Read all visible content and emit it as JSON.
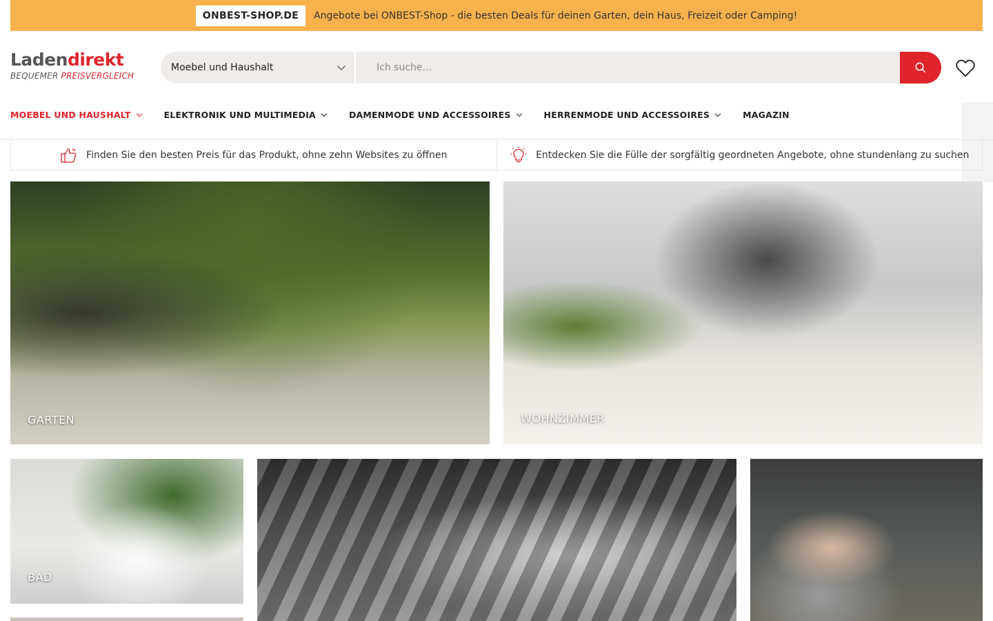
{
  "promo": {
    "badge": "ONBEST-SHOP.DE",
    "text": "Angebote bei ONBEST-Shop - die besten Deals für deinen Garten, dein Haus, Freizeit oder Camping!"
  },
  "logo": {
    "part1": "Laden",
    "part2": "direkt",
    "sub1": "BEQUEMER ",
    "sub2": "PREISVERGLEICH"
  },
  "search": {
    "category": "Moebel und Haushalt",
    "placeholder": "Ich suche...",
    "value": ""
  },
  "nav": {
    "items": [
      {
        "label": "MOEBEL UND HAUSHALT",
        "active": true
      },
      {
        "label": "ELEKTRONIK UND MULTIMEDIA"
      },
      {
        "label": "DAMENMODE UND ACCESSOIRES"
      },
      {
        "label": "HERRENMODE UND ACCESSOIRES"
      },
      {
        "label": "MAGAZIN"
      }
    ]
  },
  "features": [
    {
      "text": "Finden Sie den besten Preis für das Produkt, ohne zehn Websites zu öffnen",
      "icon": "thumbs-up-icon"
    },
    {
      "text": "Entdecken Sie die Fülle der sorgfältig geordneten Angebote, ohne stundenlang zu suchen",
      "icon": "lightbulb-icon"
    }
  ],
  "tiles": {
    "garten": "GARTEN",
    "wohnzimmer": "WOHNZIMMER",
    "bad": "BAD"
  },
  "colors": {
    "accent": "#e0242c",
    "promo_bg": "#f7b24c",
    "search_bg": "#efecea"
  }
}
